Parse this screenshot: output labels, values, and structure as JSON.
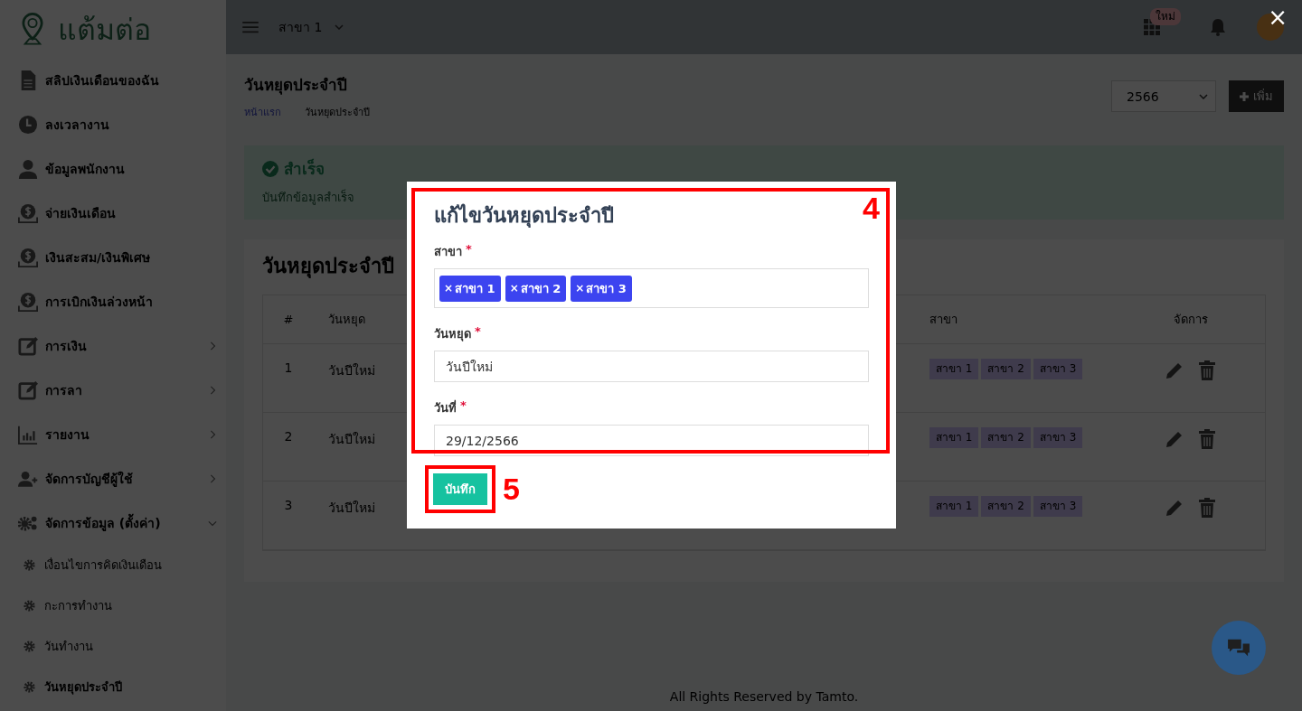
{
  "sidebar": {
    "logo": "แต้มต่อ",
    "items": [
      {
        "label": "สลิปเงินเดือนของฉัน",
        "kind": "link"
      },
      {
        "label": "ลงเวลางาน",
        "kind": "link"
      },
      {
        "label": "ข้อมูลพนักงาน",
        "kind": "link"
      },
      {
        "label": "จ่ายเงินเดือน",
        "kind": "link"
      },
      {
        "label": "เงินสะสม/เงินพิเศษ",
        "kind": "link"
      },
      {
        "label": "การเบิกเงินล่วงหน้า",
        "kind": "link"
      },
      {
        "label": "การเงิน",
        "kind": "group",
        "expanded": false
      },
      {
        "label": "การลา",
        "kind": "group",
        "expanded": false
      },
      {
        "label": "รายงาน",
        "kind": "group",
        "expanded": false
      },
      {
        "label": "จัดการบัญชีผู้ใช้",
        "kind": "group",
        "expanded": false
      },
      {
        "label": "จัดการข้อมูล (ตั้งค่า)",
        "kind": "group",
        "expanded": true,
        "children": [
          {
            "label": "เงื่อนไขการคิดเงินเดือน",
            "selected": false
          },
          {
            "label": "กะการทำงาน",
            "selected": false
          },
          {
            "label": "วันทำงาน",
            "selected": false
          },
          {
            "label": "วันหยุดประจำปี",
            "selected": true
          }
        ]
      }
    ]
  },
  "topbar": {
    "branch": "สาขา 1",
    "apps_badge": "ใหม่"
  },
  "page_header": {
    "title": "วันหยุดประจำปี",
    "breadcrumb": [
      {
        "label": "หน้าแรก",
        "kind": "link"
      },
      {
        "label": "วันหยุดประจำปี",
        "kind": "current"
      }
    ],
    "year": "2566",
    "add_button": "เพิ่ม"
  },
  "alert": {
    "title": "สำเร็จ",
    "message": "บันทึกข้อมูลสำเร็จ"
  },
  "table_card": {
    "title": "วันหยุดประจำปี",
    "columns": [
      "#",
      "วันหยุด",
      "สาขา",
      "จัดการ"
    ],
    "rows": [
      {
        "number": "1",
        "holiday": "วันปีใหม่",
        "branches": [
          "สาขา 1",
          "สาขา 2",
          "สาขา 3"
        ]
      },
      {
        "number": "2",
        "holiday": "วันปีใหม่",
        "branches": [
          "สาขา 1",
          "สาขา 2",
          "สาขา 3"
        ]
      },
      {
        "number": "3",
        "holiday": "วันปีใหม่",
        "branches": [
          "สาขา 1",
          "สาขา 2",
          "สาขา 3"
        ]
      }
    ]
  },
  "footer": "All Rights Reserved by Tamto.",
  "modal": {
    "title": "แก้ไขวันหยุดประจำปี",
    "branch_field": {
      "label": "สาขา",
      "required_mark": "*",
      "tags": [
        {
          "remove": "×",
          "label": "สาขา 1"
        },
        {
          "remove": "×",
          "label": "สาขา 2"
        },
        {
          "remove": "×",
          "label": "สาขา 3"
        }
      ]
    },
    "holiday_field": {
      "label": "วันหยุด",
      "required_mark": "*",
      "value": "วันปีใหม่"
    },
    "date_field": {
      "label": "วันที่",
      "required_mark": "*",
      "value": "29/12/2566"
    },
    "save_button": "บันทึก"
  },
  "annotations": [
    {
      "number": "4"
    },
    {
      "number": "5"
    }
  ],
  "lightbox_close": "×"
}
